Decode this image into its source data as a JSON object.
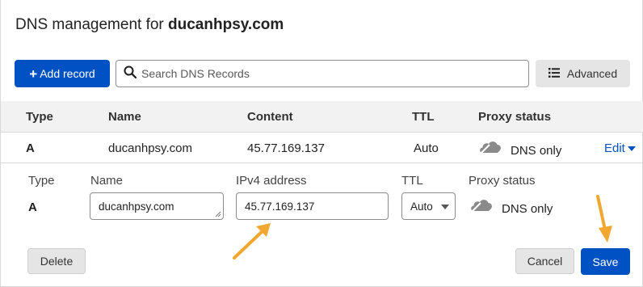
{
  "header": {
    "title_prefix": "DNS management for",
    "domain": "ducanhpsy.com"
  },
  "toolbar": {
    "add_record_label": "Add record",
    "search_placeholder": "Search DNS Records",
    "advanced_label": "Advanced"
  },
  "table": {
    "columns": [
      "Type",
      "Name",
      "Content",
      "TTL",
      "Proxy status"
    ],
    "row": {
      "type": "A",
      "name": "ducanhpsy.com",
      "content": "45.77.169.137",
      "ttl": "Auto",
      "proxy_status": "DNS only",
      "edit_label": "Edit"
    }
  },
  "editor": {
    "labels": {
      "type": "Type",
      "name": "Name",
      "ipv4": "IPv4 address",
      "ttl": "TTL",
      "proxy": "Proxy status"
    },
    "type_value": "A",
    "name_value": "ducanhpsy.com",
    "ipv4_value": "45.77.169.137",
    "ttl_value": "Auto",
    "proxy_value": "DNS only",
    "delete_label": "Delete",
    "cancel_label": "Cancel",
    "save_label": "Save"
  },
  "colors": {
    "accent": "#0051c3",
    "annotation_arrow": "#f0a830",
    "cloud_grey": "#8a8a8a"
  },
  "icons": [
    "plus-icon",
    "search-icon",
    "list-icon",
    "cloud-icon",
    "chevron-down-icon",
    "annotation-arrow"
  ]
}
